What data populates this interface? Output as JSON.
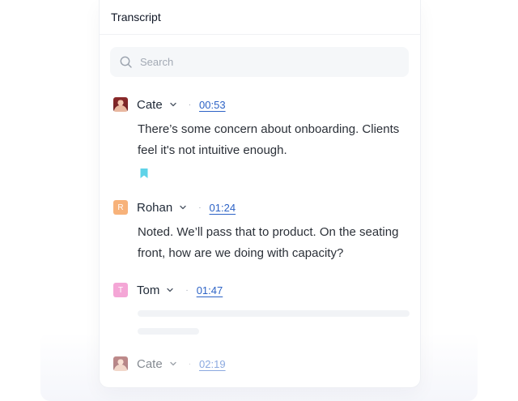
{
  "panel": {
    "title": "Transcript"
  },
  "search": {
    "placeholder": "Search",
    "value": ""
  },
  "entries": [
    {
      "speaker": "Cate",
      "avatar": {
        "type": "photo",
        "initial": ""
      },
      "timestamp": "00:53",
      "text": "There’s some concern about onboarding. Clients feel it's not intuitive enough.",
      "bookmarked": true
    },
    {
      "speaker": "Rohan",
      "avatar": {
        "type": "initial",
        "initial": "R",
        "color": "#f7b27a"
      },
      "timestamp": "01:24",
      "text": "Noted. We’ll pass that to product. On the seating front, how are we doing with capacity?",
      "bookmarked": false
    },
    {
      "speaker": "Tom",
      "avatar": {
        "type": "initial",
        "initial": "T",
        "color": "#f4a6d6"
      },
      "timestamp": "01:47",
      "text": "",
      "bookmarked": false
    },
    {
      "speaker": "Cate",
      "avatar": {
        "type": "photo",
        "initial": ""
      },
      "timestamp": "02:19",
      "text": "",
      "bookmarked": false
    }
  ],
  "icons": {
    "search": "search-icon",
    "chevron": "chevron-down-icon",
    "bookmark": "bookmark-icon"
  },
  "colors": {
    "link": "#2d63c6",
    "bookmark": "#5fd3e8"
  }
}
